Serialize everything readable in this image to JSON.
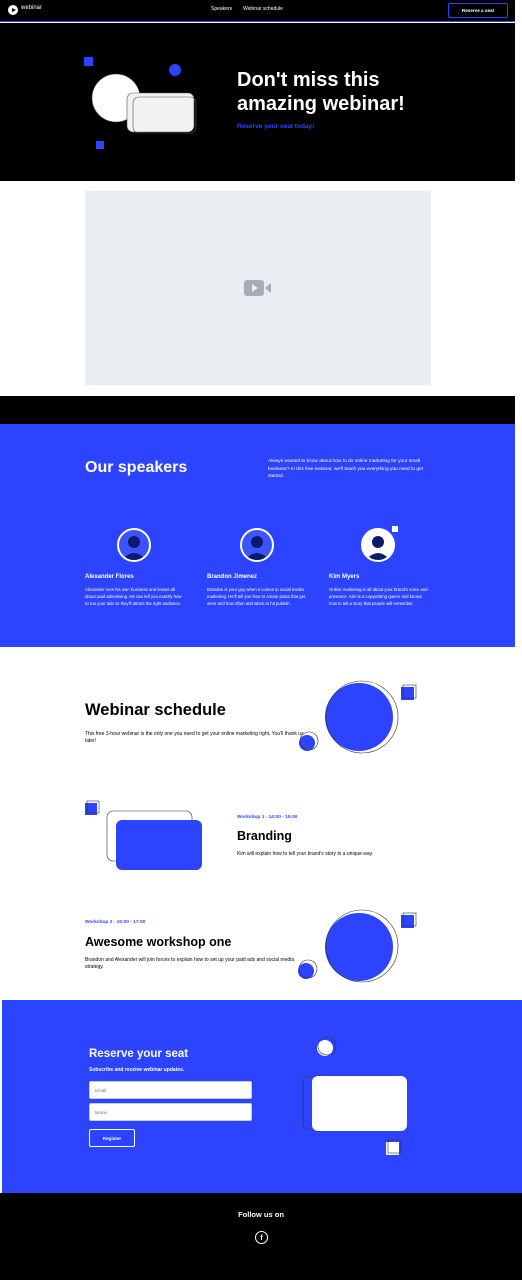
{
  "nav": {
    "logo": "webinar",
    "links": [
      "Speakers",
      "Webinar schedule"
    ],
    "cta": "Reserve a seat"
  },
  "hero": {
    "title": "Don't miss this amazing webinar!",
    "subtitle": "Reserve your seat today!"
  },
  "video": {
    "icon": "video-camera-icon"
  },
  "speakers": {
    "title": "Our speakers",
    "intro": "Always wanted to know about how to do online marketing for your small business? In this free webinar, we'll teach you everything you need to get started.",
    "items": [
      {
        "name": "Alexander Flores",
        "bio": "Alexander runs his own business and knows all about paid advertising. He can tell you exactly how to run your ads so they'll attract the right audience."
      },
      {
        "name": "Brandon Jimenez",
        "bio": "Brandon is your guy when it comes to social media marketing. He'll tell you how to create posts that get seen and how often and when to hit publish."
      },
      {
        "name": "Kim Myers",
        "bio": "Online marketing is all about your brand's voice and presence. Kim is a copywriting queen and knows how to tell a story that people will remember."
      }
    ]
  },
  "schedule": {
    "title": "Webinar schedule",
    "description": "This free 3-hour webinar is the only one you need to get your online marketing right. You'll thank us later!",
    "workshops": [
      {
        "time": "Workshop 1 · 14:00 - 15:00",
        "title": "Branding",
        "description": "Kim will explain how to tell your brand's story in a unique way."
      },
      {
        "time": "Workshop 2 · 15:00 - 17:00",
        "title": "Awesome workshop one",
        "description": "Brandon and Alexander will join forces to explain how to set up your paid ads and social media strategy."
      }
    ]
  },
  "reserve": {
    "title": "Reserve your seat",
    "subtitle": "Subscribe and receive webinar updates.",
    "email_placeholder": "Email",
    "name_placeholder": "Name",
    "button": "Register"
  },
  "footer": {
    "follow": "Follow us on",
    "social_icon": "facebook-icon",
    "facebook_glyph": "f"
  },
  "colors": {
    "accent": "#2c44ff",
    "dark": "#000000",
    "video_bg": "#eaedf1"
  }
}
